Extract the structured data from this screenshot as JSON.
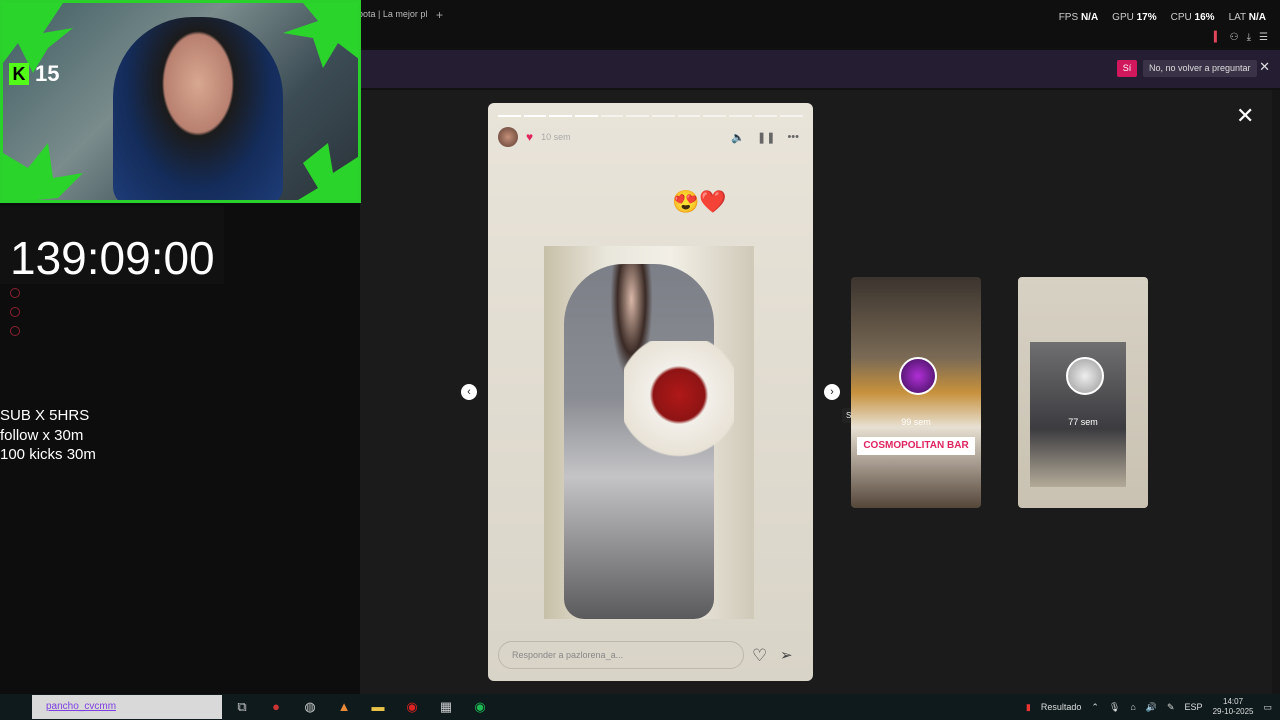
{
  "browser": {
    "tab_title": "bota | La mejor pl",
    "new_tab": "+",
    "stats": [
      {
        "label": "FPS",
        "value": "N/A"
      },
      {
        "label": "GPU",
        "value": "17%"
      },
      {
        "label": "CPU",
        "value": "16%"
      },
      {
        "label": "LAT",
        "value": "N/A"
      }
    ]
  },
  "notification": {
    "yes_label": "Sí",
    "dont_ask_label": "No, no volver a preguntar"
  },
  "stream": {
    "kick_count": "15",
    "timer": "139:09:00",
    "rules": [
      "SUB X 5HRS",
      "follow x 30m",
      "100 kicks 30m"
    ]
  },
  "story": {
    "time_ago": "10 sem",
    "emoji": "😍❤️",
    "reply_placeholder": "Responder a pazlorena_a...",
    "segments_total": 12,
    "segments_done": 4
  },
  "next": {
    "tooltip": "Siguiente",
    "cards": [
      {
        "time": "99 sem",
        "label": "COSMOPOLITAN BAR"
      },
      {
        "time": "77 sem"
      }
    ]
  },
  "chat": {
    "username": "pancho_cvcmm"
  },
  "tray": {
    "result_label": "Resultado",
    "lang": "ESP",
    "time": "14:07",
    "date": "29-10-2025"
  }
}
